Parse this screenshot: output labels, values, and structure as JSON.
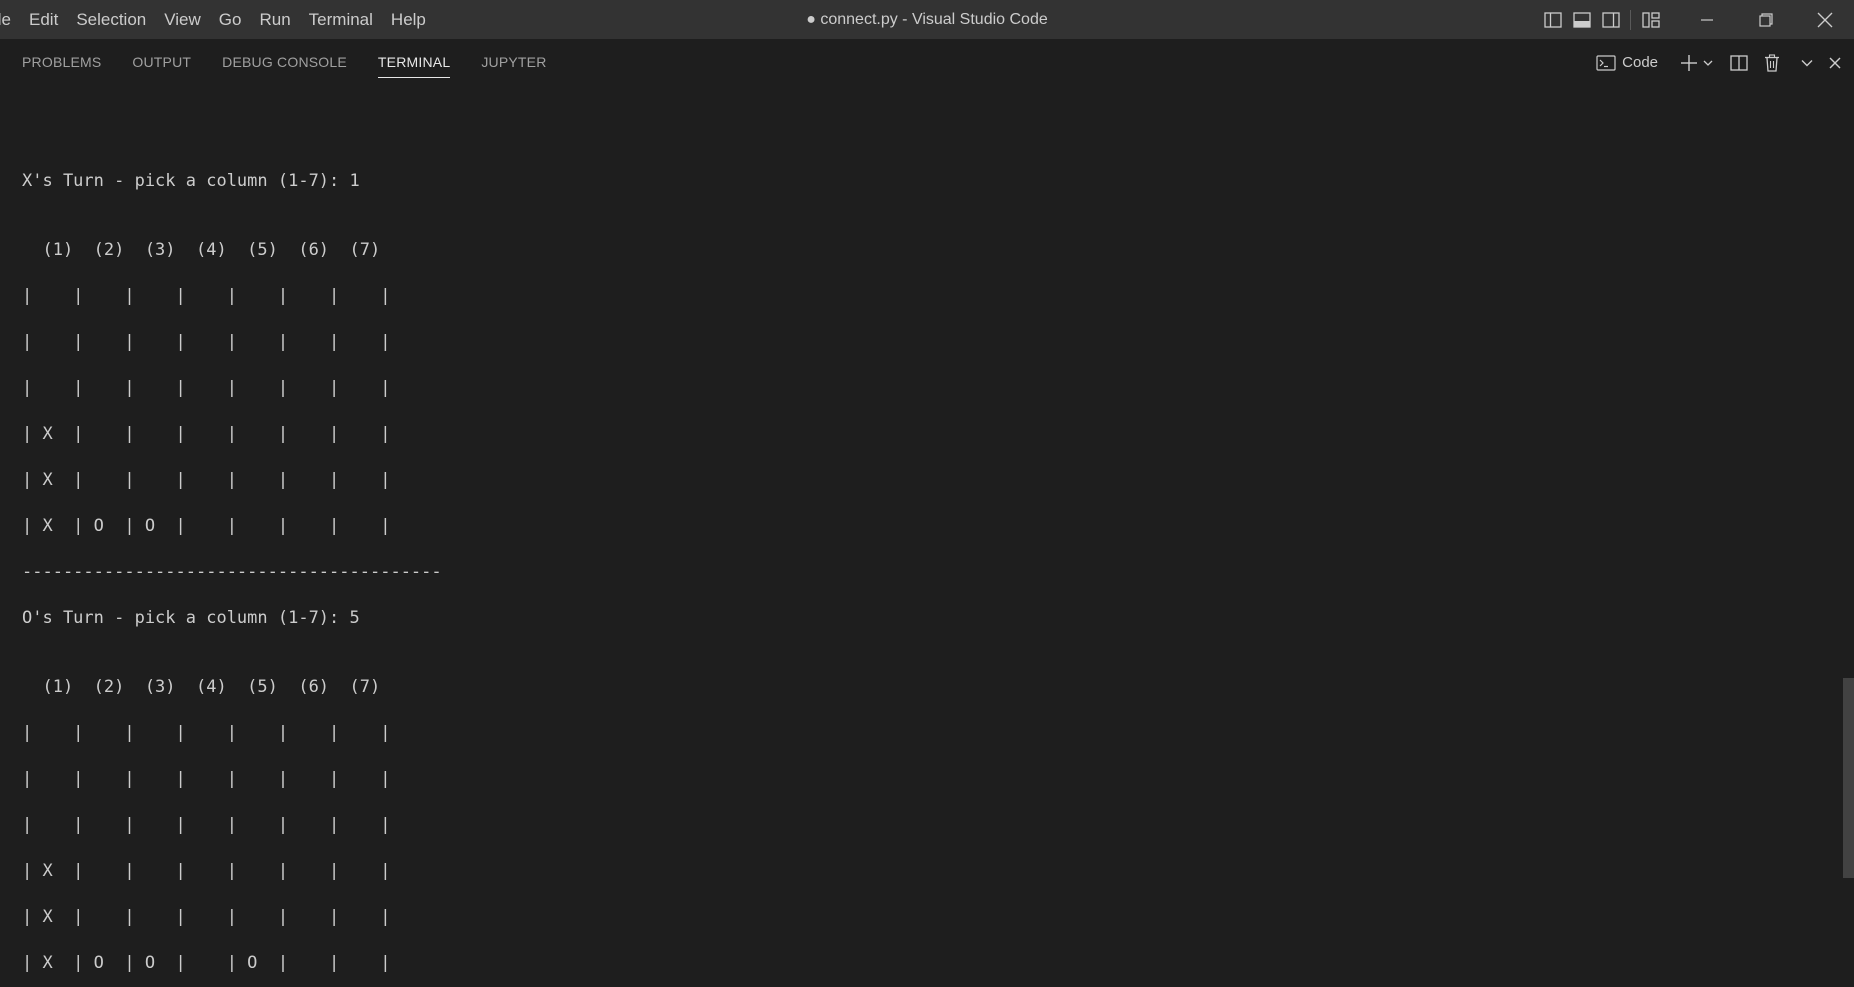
{
  "menu": [
    "ile",
    "Edit",
    "Selection",
    "View",
    "Go",
    "Run",
    "Terminal",
    "Help"
  ],
  "window": {
    "title": "● connect.py - Visual Studio Code"
  },
  "panel": {
    "tabs": [
      "PROBLEMS",
      "OUTPUT",
      "DEBUG CONSOLE",
      "TERMINAL",
      "JUPYTER"
    ],
    "active_tab": "TERMINAL",
    "profile_label": "Code"
  },
  "terminal": {
    "lines": [
      "X's Turn - pick a column (1-7): 1",
      "  (1)  (2)  (3)  (4)  (5)  (6)  (7)",
      "|    |    |    |    |    |    |    |",
      "|    |    |    |    |    |    |    |",
      "|    |    |    |    |    |    |    |",
      "| X  |    |    |    |    |    |    |",
      "| X  |    |    |    |    |    |    |",
      "| X  | O  | O  |    |    |    |    |",
      "-----------------------------------------",
      "O's Turn - pick a column (1-7): 5",
      "  (1)  (2)  (3)  (4)  (5)  (6)  (7)",
      "|    |    |    |    |    |    |    |",
      "|    |    |    |    |    |    |    |",
      "|    |    |    |    |    |    |    |",
      "| X  |    |    |    |    |    |    |",
      "| X  |    |    |    |    |    |    |",
      "| X  | O  | O  |    | O  |    |    |"
    ]
  }
}
